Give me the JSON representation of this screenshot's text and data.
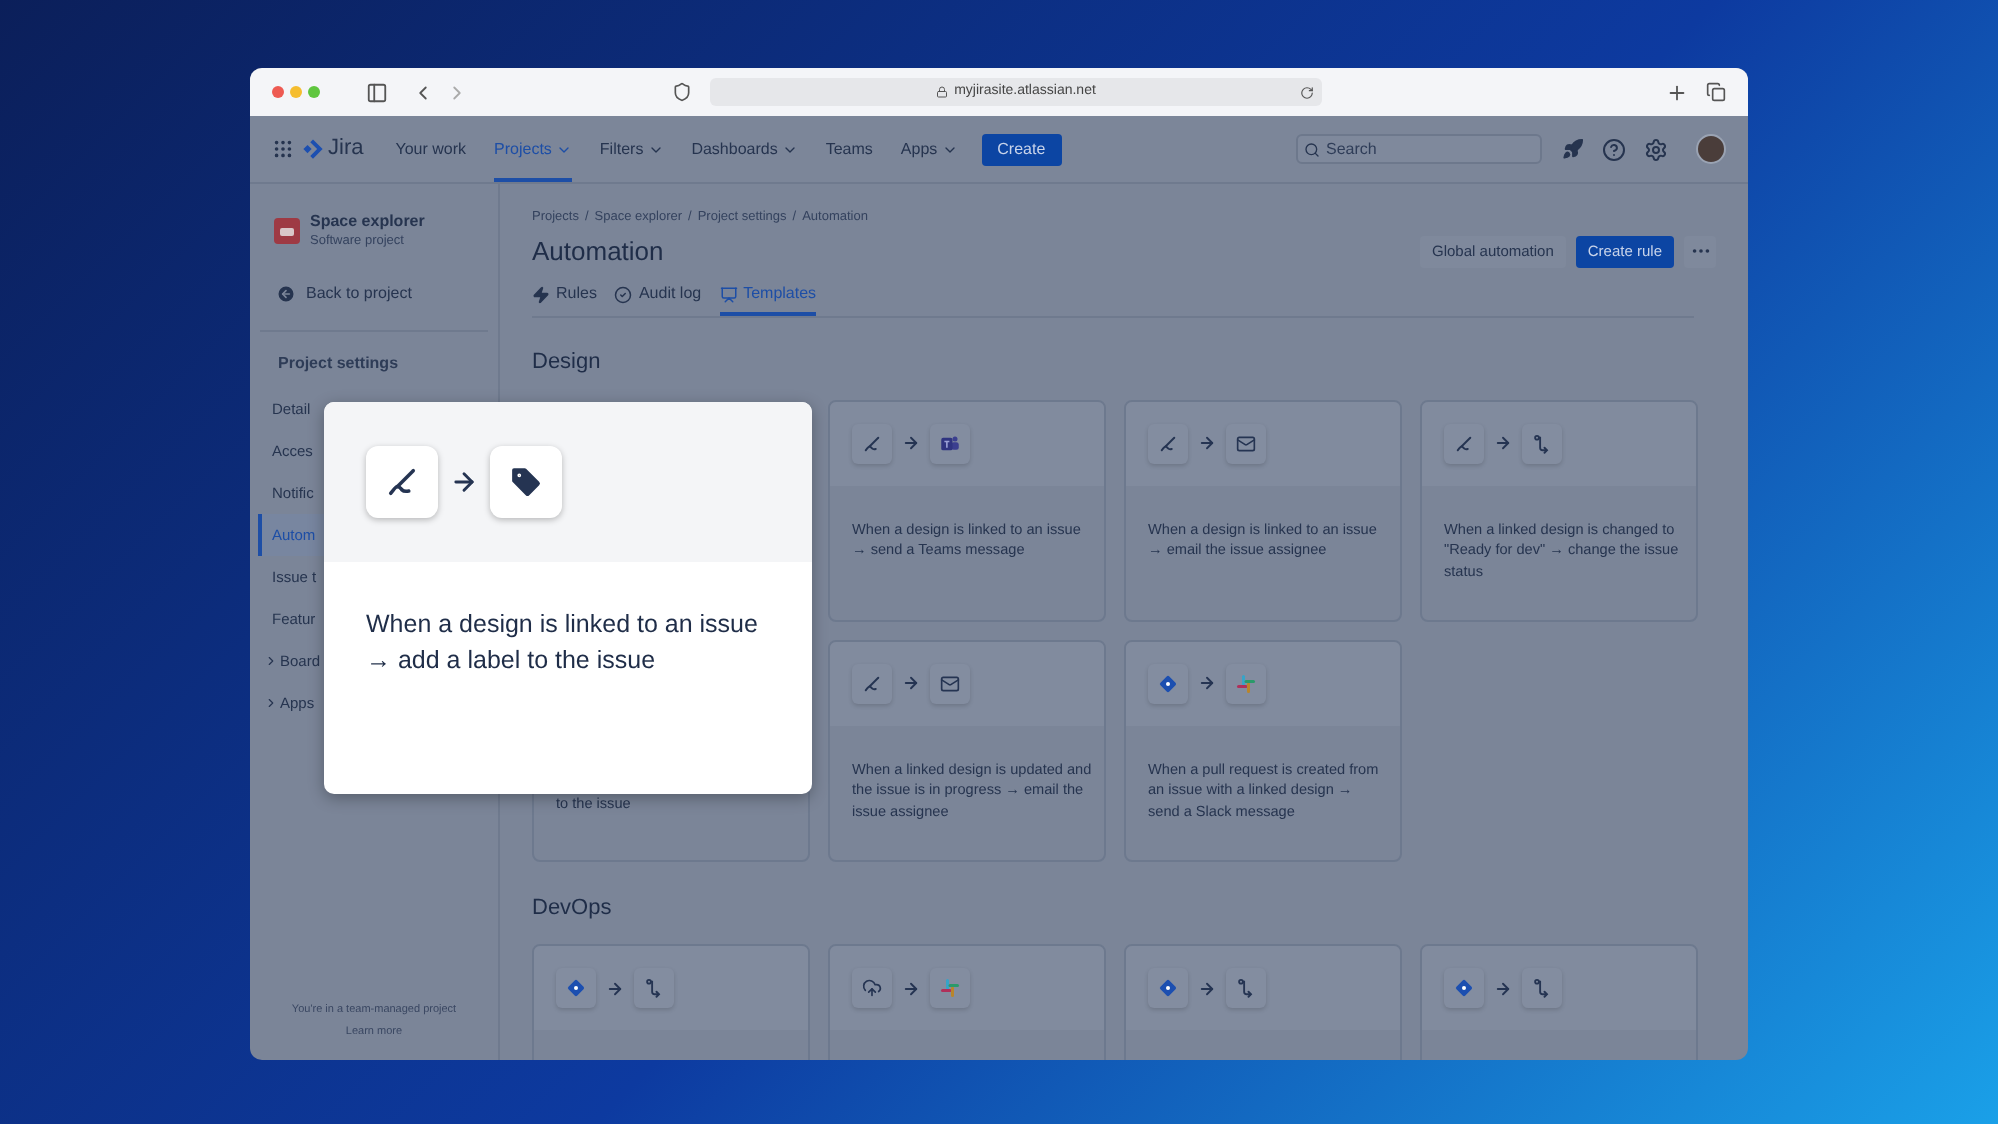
{
  "browser": {
    "url": "myjirasite.atlassian.net"
  },
  "nav": {
    "product": "Jira",
    "items": [
      {
        "label": "Your work",
        "dropdown": false,
        "selected": false
      },
      {
        "label": "Projects",
        "dropdown": true,
        "selected": true
      },
      {
        "label": "Filters",
        "dropdown": true,
        "selected": false
      },
      {
        "label": "Dashboards",
        "dropdown": true,
        "selected": false
      },
      {
        "label": "Teams",
        "dropdown": false,
        "selected": false
      },
      {
        "label": "Apps",
        "dropdown": true,
        "selected": false
      }
    ],
    "create": "Create",
    "search_placeholder": "Search"
  },
  "sidebar": {
    "project_name": "Space explorer",
    "project_type": "Software project",
    "back": "Back to project",
    "section_title": "Project settings",
    "items": [
      {
        "label": "Detail",
        "selected": false,
        "expandable": false
      },
      {
        "label": "Acces",
        "selected": false,
        "expandable": false
      },
      {
        "label": "Notific",
        "selected": false,
        "expandable": false
      },
      {
        "label": "Autom",
        "selected": true,
        "expandable": false
      },
      {
        "label": "Issue t",
        "selected": false,
        "expandable": false
      },
      {
        "label": "Featur",
        "selected": false,
        "expandable": false
      },
      {
        "label": "Board",
        "selected": false,
        "expandable": true
      },
      {
        "label": "Apps",
        "selected": false,
        "expandable": true
      }
    ],
    "footer_text": "You're in a team-managed project",
    "footer_link": "Learn more"
  },
  "main": {
    "breadcrumb_separator": "/",
    "breadcrumbs": [
      "Projects",
      "Space explorer",
      "Project settings",
      "Automation"
    ],
    "title": "Automation",
    "buttons": {
      "secondary": "Global automation",
      "primary": "Create rule"
    },
    "tabs": [
      {
        "label": "Rules",
        "kind": "bolt",
        "selected": false
      },
      {
        "label": "Audit log",
        "kind": "check",
        "selected": false
      },
      {
        "label": "Templates",
        "kind": "template",
        "selected": true
      }
    ],
    "sections": [
      {
        "title": "Design",
        "cards": [
          {
            "icons": [
              {
                "kind": "design"
              },
              {
                "kind": "teams"
              }
            ],
            "text": "When a design is linked to an issue → send a Teams message"
          },
          {
            "icons": [
              {
                "kind": "design"
              },
              {
                "kind": "mail"
              }
            ],
            "text": "When a design is linked to an issue → email the issue assignee"
          },
          {
            "icons": [
              {
                "kind": "design"
              },
              {
                "kind": "transition"
              }
            ],
            "text": "When a linked design is changed to \"Ready for dev\" → change the issue status"
          },
          {
            "text": "to the issue"
          },
          {
            "icons": [
              {
                "kind": "design"
              },
              {
                "kind": "mail"
              }
            ],
            "text": "When a linked design is updated and the issue is in progress → email the issue assignee"
          },
          {
            "icons": [
              {
                "kind": "pull-request"
              },
              {
                "kind": "slack"
              }
            ],
            "text": "When a pull request is created from an issue with a linked design → send a Slack message"
          }
        ]
      },
      {
        "title": "DevOps",
        "cards": [
          {
            "icons": [
              {
                "kind": "pull-request"
              },
              {
                "kind": "transition"
              }
            ]
          },
          {
            "icons": [
              {
                "kind": "cloud"
              },
              {
                "kind": "slack"
              }
            ]
          },
          {
            "icons": [
              {
                "kind": "pull-request"
              },
              {
                "kind": "transition"
              }
            ]
          },
          {
            "icons": [
              {
                "kind": "pull-request"
              },
              {
                "kind": "transition"
              }
            ]
          }
        ]
      }
    ]
  },
  "highlight_card": {
    "icons": [
      {
        "kind": "design"
      },
      {
        "kind": "tag"
      }
    ],
    "text": "When a design is linked to an issue → add a label to the issue"
  }
}
